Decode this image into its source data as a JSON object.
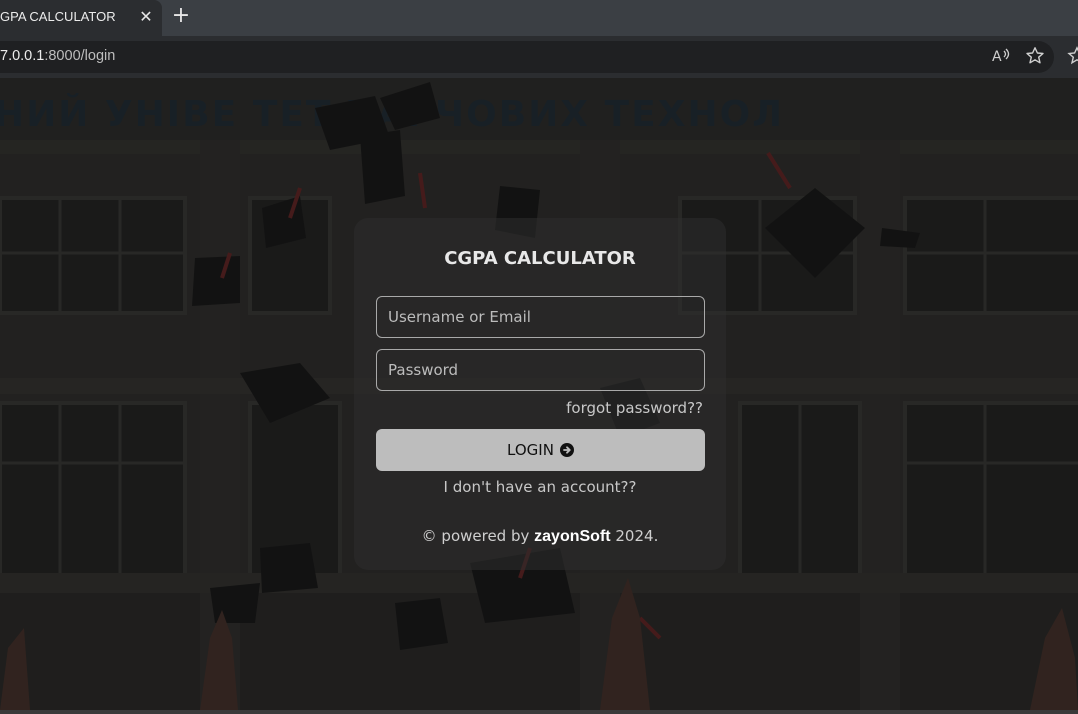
{
  "browser": {
    "tab_title": "GPA CALCULATOR",
    "close_glyph": "✕",
    "new_tab_glyph": "+",
    "url_host": "7.0.0.1",
    "url_rest": ":8000/login",
    "toolbar_icons": [
      "read-aloud-icon",
      "favorite-star-icon"
    ]
  },
  "page": {
    "background_text": "НИЙ УНІВЕ  ТЕТ ХАРЧОВИХ ТЕХНОЛ",
    "title": "CGPA CALCULATOR",
    "username_placeholder": "Username or Email",
    "password_placeholder": "Password",
    "forgot_label": "forgot password??",
    "login_label": "LOGIN",
    "no_account_label": "I don't have an account??",
    "footer_prefix": "© powered by",
    "footer_brand": "zayonSoft",
    "footer_suffix": "2024."
  },
  "colors": {
    "tabbar": "#3b3f44",
    "toolbar": "#2b2d30",
    "card": "#2d2d2d",
    "button": "#bdbdbd"
  }
}
